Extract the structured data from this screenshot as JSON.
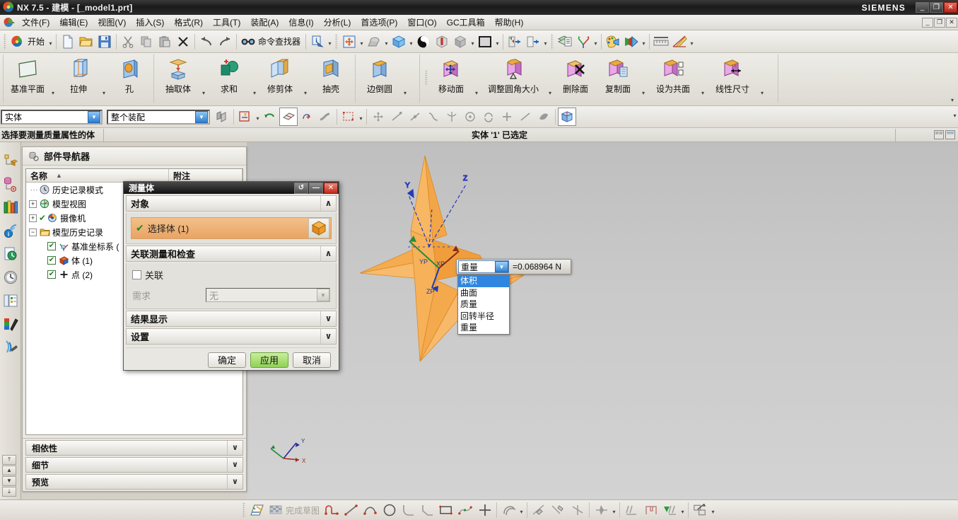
{
  "window": {
    "title": "NX 7.5 - 建模 - [_model1.prt]",
    "brand": "SIEMENS",
    "minimize": "_",
    "maximize": "❐",
    "close": "✕"
  },
  "menubar": {
    "items": [
      {
        "label": "文件(F)"
      },
      {
        "label": "编辑(E)"
      },
      {
        "label": "视图(V)"
      },
      {
        "label": "插入(S)"
      },
      {
        "label": "格式(R)"
      },
      {
        "label": "工具(T)"
      },
      {
        "label": "装配(A)"
      },
      {
        "label": "信息(I)"
      },
      {
        "label": "分析(L)"
      },
      {
        "label": "首选项(P)"
      },
      {
        "label": "窗口(O)"
      },
      {
        "label": "GC工具箱"
      },
      {
        "label": "帮助(H)"
      }
    ],
    "doc_min": "_",
    "doc_max": "❐",
    "doc_close": "✕"
  },
  "toolbar": {
    "start_label": "开始",
    "start_caret": "▾",
    "command_finder_label": "命令查找器",
    "caret": "▾"
  },
  "ribbon": {
    "groups": [
      {
        "items": [
          {
            "label": "基准平面",
            "icon": "datum-plane-icon",
            "caret": true
          },
          {
            "label": "拉伸",
            "icon": "extrude-icon",
            "caret": true
          },
          {
            "label": "孔",
            "icon": "hole-icon",
            "caret": false
          }
        ]
      },
      {
        "items": [
          {
            "label": "抽取体",
            "icon": "extract-body-icon",
            "caret": true
          },
          {
            "label": "求和",
            "icon": "unite-icon",
            "caret": true
          },
          {
            "label": "修剪体",
            "icon": "trim-body-icon",
            "caret": true
          },
          {
            "label": "抽壳",
            "icon": "shell-icon",
            "caret": false
          }
        ]
      },
      {
        "items": [
          {
            "label": "边倒圆",
            "icon": "edge-blend-icon",
            "caret": true
          }
        ]
      },
      {
        "items": [
          {
            "label": "移动面",
            "icon": "move-face-icon",
            "caret": true
          },
          {
            "label": "调整圆角大小",
            "icon": "resize-blend-icon",
            "caret": true
          },
          {
            "label": "删除面",
            "icon": "delete-face-icon",
            "caret": false
          },
          {
            "label": "复制面",
            "icon": "copy-face-icon",
            "caret": true
          },
          {
            "label": "设为共面",
            "icon": "make-coplanar-icon",
            "caret": true
          },
          {
            "label": "线性尺寸",
            "icon": "linear-dimension-icon",
            "caret": true
          }
        ]
      }
    ],
    "overflow_caret": "▾"
  },
  "selection_bar": {
    "type_filter": {
      "value": "实体",
      "arrow": "▼"
    },
    "scope_filter": {
      "value": "整个装配",
      "arrow": "▼"
    },
    "caret": "▾"
  },
  "status": {
    "cue": "选择要测量质量属性的体",
    "message": "实体 '1' 已选定"
  },
  "part_navigator": {
    "title": "部件导航器",
    "columns": [
      {
        "label": "名称",
        "sort": "▲"
      },
      {
        "label": "附注"
      }
    ],
    "tree": [
      {
        "label": "历史记录模式",
        "icon": "clock-icon",
        "twisty": "",
        "check": false,
        "indent": 0
      },
      {
        "label": "模型视图",
        "icon": "model-views-icon",
        "twisty": "+",
        "check": false,
        "indent": 0
      },
      {
        "label": "摄像机",
        "icon": "camera-icon",
        "twisty": "+",
        "check": true,
        "indent": 0
      },
      {
        "label": "模型历史记录",
        "icon": "folder-icon",
        "twisty": "−",
        "check": false,
        "indent": 0
      },
      {
        "label": "基准坐标系 (",
        "icon": "datum-csys-icon",
        "twisty": "",
        "check": true,
        "indent": 1
      },
      {
        "label": "体 (1)",
        "icon": "body-icon",
        "twisty": "",
        "check": true,
        "indent": 1
      },
      {
        "label": "点 (2)",
        "icon": "point-icon",
        "twisty": "",
        "check": true,
        "indent": 1
      }
    ],
    "sections": [
      {
        "label": "相依性",
        "chev": "∨"
      },
      {
        "label": "细节",
        "chev": "∨"
      },
      {
        "label": "预览",
        "chev": "∨"
      }
    ]
  },
  "dialog": {
    "title": "测量体",
    "reset_icon": "↺",
    "minimize": "—",
    "close": "✕",
    "groups": {
      "object": {
        "header": "对象",
        "chev": "∧",
        "select_label": "选择体 (1)",
        "check_mark": "✔",
        "body_icon": "solid-body-icon"
      },
      "associative": {
        "header": "关联测量和检查",
        "chev": "∧",
        "checkbox_label": "关联",
        "checkbox_checked": false,
        "requirement_label": "需求",
        "requirement_value": "无",
        "requirement_arrow": "▼"
      },
      "results": {
        "header": "结果显示",
        "chev": "∨"
      },
      "settings": {
        "header": "设置",
        "chev": "∨"
      }
    },
    "buttons": {
      "ok": "确定",
      "apply": "应用",
      "cancel": "取消"
    }
  },
  "measure_hud": {
    "selected": "重量",
    "arrow": "▼",
    "value": "=0.068964 N",
    "options": [
      {
        "label": "体积",
        "selected": true
      },
      {
        "label": "曲面",
        "selected": false
      },
      {
        "label": "质量",
        "selected": false
      },
      {
        "label": "回转半径",
        "selected": false
      },
      {
        "label": "重量",
        "selected": false
      }
    ]
  },
  "viewport": {
    "axis_labels": {
      "y": "Y",
      "z": "Z",
      "xp": "XP",
      "yp": "YP",
      "zp": "ZP"
    },
    "model_color": "#F5A54B",
    "model_color_dark": "#E08C2E",
    "background_top": "#bfbfbf",
    "background_bottom": "#d3d3d3"
  },
  "bottom_toolbar": {
    "finish_sketch_label": "完成草图",
    "caret": "▾"
  },
  "colors": {
    "accent_blue": "#2f86e0",
    "apply_green": "#8fd155",
    "select_orange": "#e8a463",
    "titlebar_dark": "#1a1a1a"
  }
}
